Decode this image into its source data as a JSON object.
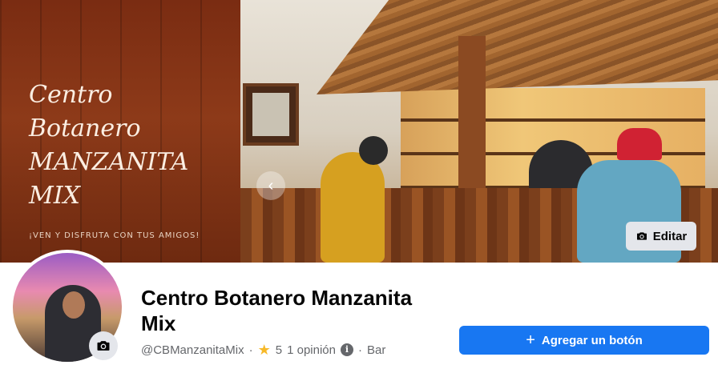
{
  "cover": {
    "title": "Centro\nBotanero\nMANZANITA\nMIX",
    "tagline": "¡VEN Y DISFRUTA CON TUS AMIGOS!",
    "edit_label": "Editar",
    "edit_icon": "camera-icon"
  },
  "profile": {
    "camera_icon": "camera-icon"
  },
  "page": {
    "name": "Centro Botanero Manzanita Mix",
    "handle": "@CBManzanitaMix",
    "separator": "·",
    "rating": "5",
    "reviews": "1 opinión",
    "category": "Bar",
    "star_icon": "star-icon",
    "info_icon": "info-icon"
  },
  "actions": {
    "add_button_label": "Agregar un botón"
  },
  "colors": {
    "primary": "#1877f2",
    "star": "#f7b928",
    "secondary_text": "#65676b"
  }
}
